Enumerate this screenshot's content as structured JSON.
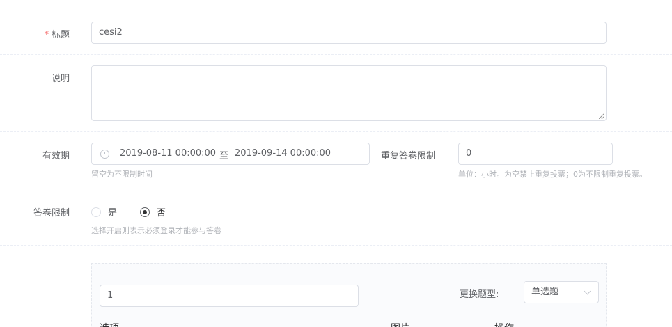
{
  "form": {
    "title": {
      "required_mark": "*",
      "label": "标题",
      "value": "cesi2"
    },
    "description": {
      "label": "说明",
      "value": ""
    },
    "validity": {
      "label": "有效期",
      "start": "2019-08-11 00:00:00",
      "separator": "至",
      "end": "2019-09-14 00:00:00",
      "hint": "留空为不限制时间"
    },
    "repeat_limit": {
      "label": "重复答卷限制",
      "value": "0",
      "hint": "单位：小时。为空禁止重复投票；0为不限制重复投票。"
    },
    "answer_limit": {
      "label": "答卷限制",
      "options": [
        "是",
        "否"
      ],
      "selected": "否",
      "hint": "选择开启则表示必须登录才能参与答卷"
    },
    "question": {
      "title_value": "1",
      "change_type_label": "更换题型:",
      "type_selected": "单选题",
      "columns": [
        "选项",
        "图片",
        "操作"
      ]
    }
  },
  "colors": {
    "required": "#f56c6c",
    "border": "#dcdfe6",
    "hint": "#b0b3b8"
  }
}
